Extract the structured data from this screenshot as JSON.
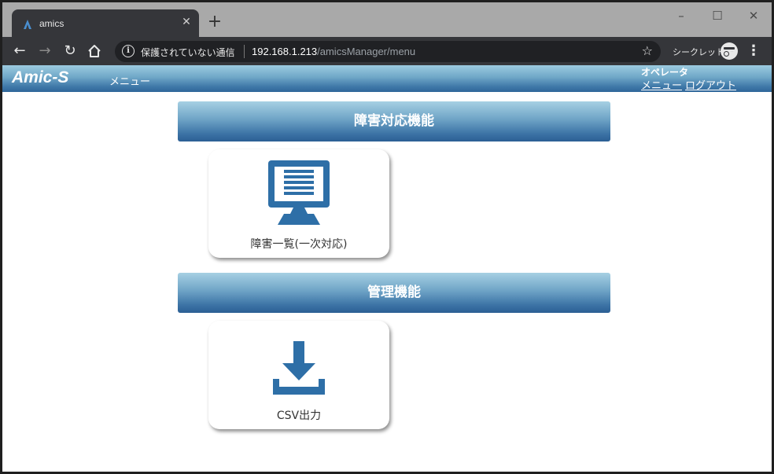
{
  "browser": {
    "tab_title": "amics",
    "tab_close": "✕",
    "new_tab": "+",
    "security_text": "保護されていない通信",
    "url_host": "192.168.1.213",
    "url_path": "/amicsManager/menu",
    "incognito_label": "シークレット"
  },
  "header": {
    "logo": "Amic-S",
    "nav_title": "メニュー",
    "user_role": "オペレータ",
    "menu_link": "メニュー",
    "logout_link": "ログアウト"
  },
  "sections": [
    {
      "title": "障害対応機能",
      "items": [
        {
          "label": "障害一覧(一次対応)",
          "icon": "monitor-list-icon"
        }
      ]
    },
    {
      "title": "管理機能",
      "items": [
        {
          "label": "CSV出力",
          "icon": "download-icon"
        }
      ]
    }
  ],
  "colors": {
    "accent_blue": "#2f6ea8",
    "icon_blue": "#2e6fa7"
  }
}
